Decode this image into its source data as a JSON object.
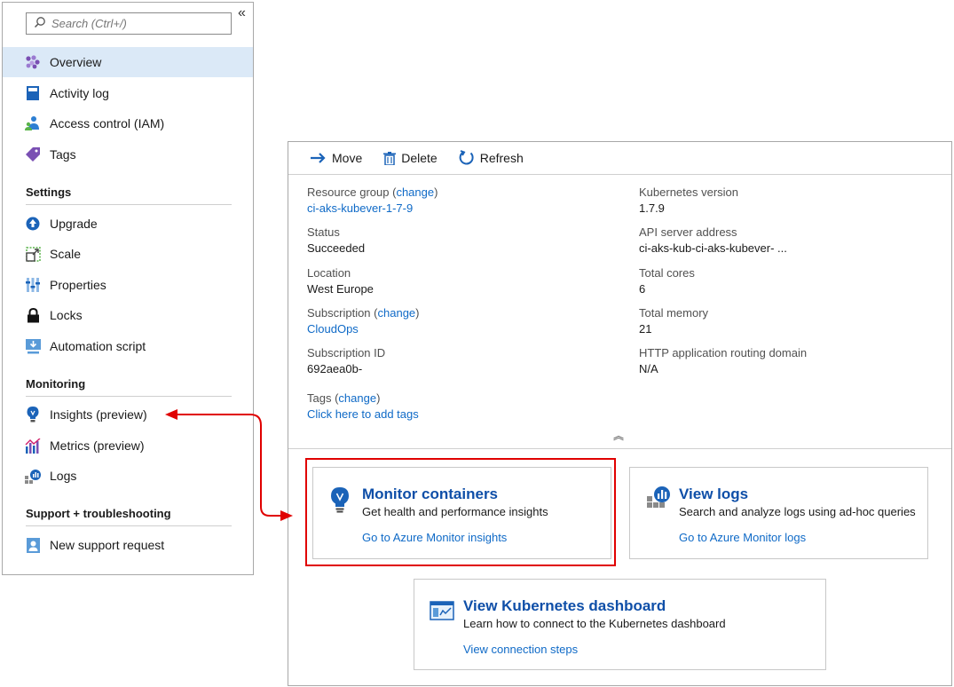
{
  "nav": {
    "search_placeholder": "Search (Ctrl+/)",
    "collapse_glyph": "«",
    "items_top": [
      {
        "label": "Overview",
        "icon": "overview-icon"
      },
      {
        "label": "Activity log",
        "icon": "activity-log-icon"
      },
      {
        "label": "Access control (IAM)",
        "icon": "iam-icon"
      },
      {
        "label": "Tags",
        "icon": "tag-icon"
      }
    ],
    "settings": {
      "title": "Settings",
      "items": [
        {
          "label": "Upgrade",
          "icon": "upgrade-icon"
        },
        {
          "label": "Scale",
          "icon": "scale-icon"
        },
        {
          "label": "Properties",
          "icon": "properties-icon"
        },
        {
          "label": "Locks",
          "icon": "lock-icon"
        },
        {
          "label": "Automation script",
          "icon": "automation-script-icon"
        }
      ]
    },
    "monitoring": {
      "title": "Monitoring",
      "items": [
        {
          "label": "Insights (preview)",
          "icon": "insights-icon"
        },
        {
          "label": "Metrics (preview)",
          "icon": "metrics-icon"
        },
        {
          "label": "Logs",
          "icon": "logs-icon"
        }
      ]
    },
    "support": {
      "title": "Support + troubleshooting",
      "items": [
        {
          "label": "New support request",
          "icon": "support-request-icon"
        }
      ]
    }
  },
  "toolbar": {
    "move": "Move",
    "delete": "Delete",
    "refresh": "Refresh"
  },
  "essentials": {
    "resource_group_label": "Resource group",
    "change": "change",
    "resource_group_value": "ci-aks-kubever-1-7-9",
    "status_label": "Status",
    "status_value": "Succeeded",
    "location_label": "Location",
    "location_value": "West Europe",
    "subscription_label": "Subscription",
    "subscription_value": "CloudOps",
    "subscription_id_label": "Subscription ID",
    "subscription_id_value": "692aea0b-",
    "tags_label": "Tags",
    "tags_value": "Click here to add tags",
    "k8s_version_label": "Kubernetes version",
    "k8s_version_value": "1.7.9",
    "api_server_label": "API server address",
    "api_server_value": "ci-aks-kub-ci-aks-kubever-  ...",
    "cores_label": "Total cores",
    "cores_value": "6",
    "memory_label": "Total memory",
    "memory_value": "21",
    "http_routing_label": "HTTP application routing domain",
    "http_routing_value": "N/A",
    "collapse_glyph": "︽"
  },
  "cards": {
    "monitor": {
      "title": "Monitor containers",
      "desc": "Get health and performance insights",
      "link": "Go to Azure Monitor insights"
    },
    "logs": {
      "title": "View logs",
      "desc": "Search and analyze logs using ad-hoc queries",
      "link": "Go to Azure Monitor logs"
    },
    "dashboard": {
      "title": "View Kubernetes dashboard",
      "desc": "Learn how to connect to the Kubernetes dashboard",
      "link": "View connection steps"
    }
  },
  "colors": {
    "accent": "#0f6ac7",
    "highlight": "#e00000",
    "active_bg": "#dbe9f7"
  }
}
